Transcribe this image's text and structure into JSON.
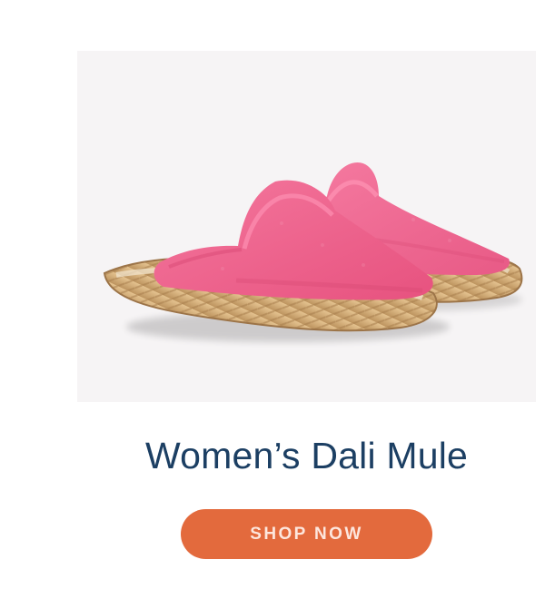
{
  "product": {
    "name": "Women’s Dali Mule",
    "image": {
      "subject": "pink-espadrille-mule-pair-image",
      "upper_color": "#f06b91",
      "sole_color": "#d7b27d",
      "background_color": "#f6f4f5"
    }
  },
  "cta": {
    "label": "SHOP NOW",
    "color": "#e36a3d",
    "text_color": "#fde6dd"
  }
}
